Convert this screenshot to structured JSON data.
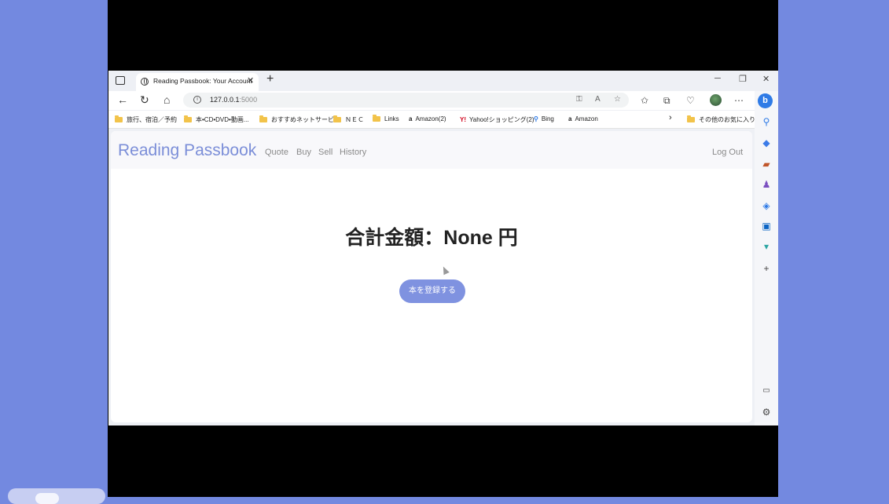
{
  "browser": {
    "tab_title": "Reading Passbook: Your Account",
    "url_host": "127.0.0.1",
    "url_port": ":5000",
    "bookmarks": [
      {
        "label": "旅行、宿泊／予約",
        "icon": "folder"
      },
      {
        "label": "本•CD•DVD•動画...",
        "icon": "folder"
      },
      {
        "label": "おすすめネットサービス",
        "icon": "folder"
      },
      {
        "label": "ＮＥＣ",
        "icon": "folder"
      },
      {
        "label": "Links",
        "icon": "folder"
      },
      {
        "label": "Amazon(2)",
        "icon": "amazon"
      },
      {
        "label": "Yahoo!ショッピング(2)",
        "icon": "yahoo"
      },
      {
        "label": "Bing",
        "icon": "search"
      },
      {
        "label": "Amazon",
        "icon": "amazon"
      }
    ],
    "other_favorites": "その他のお気に入り"
  },
  "app": {
    "brand": "Reading Passbook",
    "nav": [
      "Quote",
      "Buy",
      "Sell",
      "History"
    ],
    "logout": "Log Out",
    "total_text": "合計金額：None 円",
    "register_button": "本を登録する"
  },
  "colors": {
    "brand": "#7b8ed8",
    "button": "#7f92e0",
    "background": "#7389e0"
  }
}
